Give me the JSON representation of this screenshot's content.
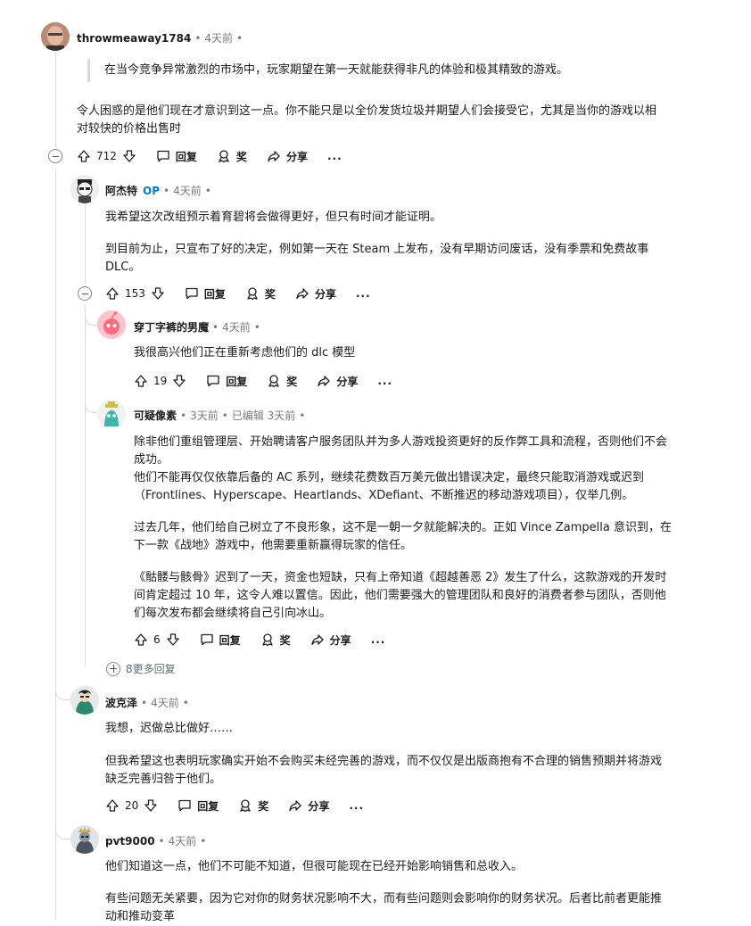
{
  "comments": [
    {
      "user": "throwmeaway1784",
      "time": "4天前",
      "quote": "在当今竞争异常激烈的市场中，玩家期望在第一天就能获得非凡的体验和极其精致的游戏。",
      "lines": [
        "令人困惑的是他们现在才意识到这一点。你不能只是以全价发货垃圾并期望人们会接受它，尤其是当你的游戏以相",
        "对较快的价格出售时"
      ],
      "votes": "712"
    },
    {
      "user": "阿杰特",
      "op": "OP",
      "time": "4天前",
      "lines": [
        "我希望这次改组预示着育碧将会做得更好，但只有时间才能证明。",
        "",
        "到目前为止，只宣布了好的决定，例如第一天在 Steam 上发布，没有早期访问废话，没有季票和免费故事",
        "DLC。"
      ],
      "votes": "153"
    },
    {
      "user": "穿丁字裤的男魔",
      "time": "4天前",
      "lines": [
        "我很高兴他们正在重新考虑他们的 dlc 模型"
      ],
      "votes": "19"
    },
    {
      "user": "可疑像素",
      "time": "3天前",
      "edited": "已编辑 3天前",
      "lines": [
        "除非他们重组管理层、开始聘请客户服务团队并为多人游戏投资更好的反作弊工具和流程，否则他们不会",
        "成功。",
        "他们不能再仅仅依靠后备的 AC 系列，继续花费数百万美元做出错误决定，最终只能取消游戏或迟到",
        "（Frontlines、Hyperscape、Heartlands、XDefiant、不断推迟的移动游戏项目），仅举几例。",
        "",
        "过去几年，他们给自己树立了不良形象，这不是一朝一夕就能解决的。正如 Vince Zampella 意识到，在",
        "下一款《战地》游戏中，他需要重新赢得玩家的信任。",
        "",
        "《骷髅与骸骨》迟到了一天，资金也短缺，只有上帝知道《超越善恶 2》发生了什么，这款游戏的开发时",
        "间肯定超过 10 年，这令人难以置信。因此，他们需要强大的管理团队和良好的消费者参与团队，否则他",
        "们每次发布都会继续将自己引向冰山。"
      ],
      "votes": "6"
    },
    {
      "user": "波克泽",
      "time": "4天前",
      "lines": [
        "我想，迟做总比做好……",
        "",
        "但我希望这也表明玩家确实开始不会购买未经完善的游戏，而不仅仅是出版商抱有不合理的销售预期并将游戏",
        "缺乏完善归咎于他们。"
      ],
      "votes": "20"
    },
    {
      "user": "pvt9000",
      "time": "4天前",
      "lines": [
        "他们知道这一点，他们不可能不知道，但很可能现在已经开始影响销售和总收入。",
        "",
        "有些问题无关紧要，因为它对你的财务状况影响不大，而有些问题则会影响你的财务状况。后者比前者更能推",
        "动和推动变革"
      ]
    }
  ],
  "actions": {
    "reply": "回复",
    "award": "奖",
    "share": "分享",
    "more": "..."
  },
  "more_replies": "8更多回复",
  "icons": [
    "upvote-icon",
    "downvote-icon",
    "reply-icon",
    "award-icon",
    "share-icon",
    "collapse-icon",
    "expand-icon"
  ]
}
